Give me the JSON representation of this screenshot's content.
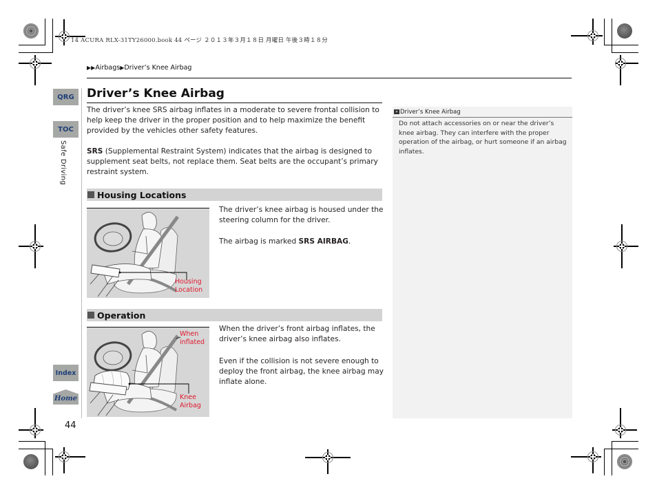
{
  "print_header": "14 ACURA RLX-31TY26000.book  44 ページ  ２０１３年３月１８日  月曜日  午後３時１８分",
  "breadcrumb": {
    "items": [
      "Airbags",
      "Driver’s Knee Airbag"
    ],
    "separator_icon": "right-triangle-icon"
  },
  "side_nav": {
    "qrg_label": "QRG",
    "toc_label": "TOC",
    "section_tab": "Safe Driving",
    "index_label": "Index",
    "home_label": "Home"
  },
  "page_number": "44",
  "main": {
    "title": "Driver’s Knee Airbag",
    "intro_paragraph": "The driver’s knee SRS airbag inflates in a moderate to severe frontal collision to help keep the driver in the proper position and to help maximize the benefit provided by the vehicles other safety features.",
    "srs_term": "SRS",
    "srs_paragraph": " (Supplemental Restraint System) indicates that the airbag is designed to supplement seat belts, not replace them. Seat belts are the occupant’s primary restraint system.",
    "sections": [
      {
        "heading": "Housing Locations",
        "illustration_callouts": [
          "Housing",
          "Location"
        ],
        "paragraph1": "The driver’s knee airbag is housed under the steering column for the driver.",
        "paragraph2_prefix": "The airbag is marked ",
        "paragraph2_bold": "SRS AIRBAG",
        "paragraph2_suffix": "."
      },
      {
        "heading": "Operation",
        "illustration_callouts_top": [
          "When",
          "inflated"
        ],
        "illustration_callouts_bottom": [
          "Knee",
          "Airbag"
        ],
        "paragraph1": "When the driver’s front airbag inflates, the driver’s knee airbag also inflates.",
        "paragraph2": "Even if the collision is not severe enough to deploy the front airbag, the knee airbag may inflate alone."
      }
    ]
  },
  "side_note": {
    "heading": "Driver’s Knee Airbag",
    "text": "Do not attach accessories on or near the driver’s knee airbag. They can interfere with the proper operation of the airbag, or hurt someone if an airbag inflates."
  },
  "colors": {
    "callout_red": "#e0182d",
    "nav_button_bg": "#a6a8a5",
    "nav_button_text": "#1e3f78",
    "section_bar_bg": "#d3d3d3",
    "note_bg": "#f2f2f2"
  }
}
